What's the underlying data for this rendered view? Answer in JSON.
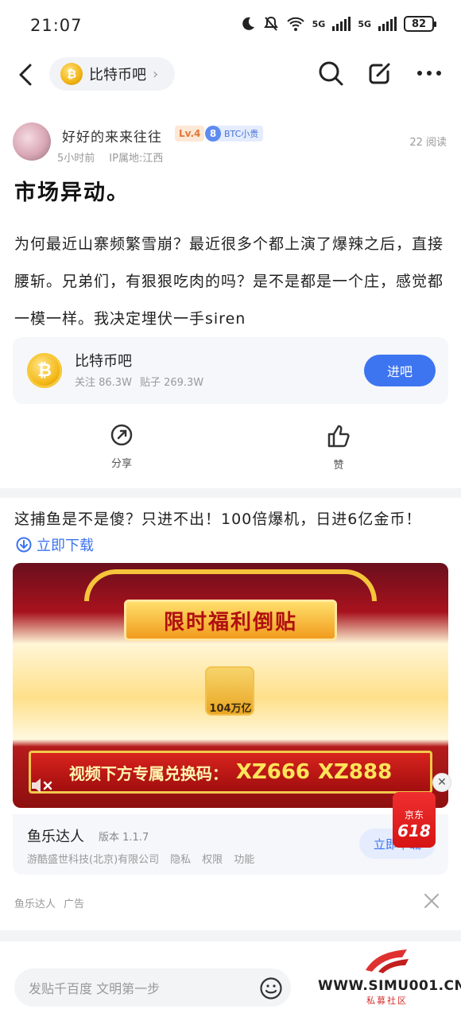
{
  "status_bar": {
    "time": "21:07",
    "network_1": "5G",
    "network_2": "5G",
    "battery": "82"
  },
  "nav": {
    "forum_name": "比特币吧",
    "coin_symbol": "₿"
  },
  "author": {
    "name": "好好的来来往往",
    "level": "Lv.4",
    "badge_number": "8",
    "badge_text": "BTC小贵",
    "time": "5小时前",
    "ip": "IP属地:江西",
    "reads": "22 阅读"
  },
  "post": {
    "title": "市场异动。",
    "body": "为何最近山寨频繁雪崩？最近很多个都上演了爆辣之后，直接腰斩。兄弟们，有狠狠吃肉的吗？是不是都是一个庄，感觉都一模一样。我决定埋伏一手siren"
  },
  "forum_card": {
    "name": "比特币吧",
    "follows": "关注 86.3W",
    "posts": "贴子 269.3W",
    "enter_label": "进吧"
  },
  "actions": {
    "share_label": "分享",
    "like_label": "赞"
  },
  "ad": {
    "headline": "这捕鱼是不是傻？只进不出！100倍爆机，日进6亿金币！",
    "download_label": "立即下载",
    "banner_title": "限时福利倒贴",
    "coin_label": "104万亿",
    "code_label": "视频下方专属兑换码：",
    "code_1": "XZ666",
    "code_2": "XZ888",
    "app_name": "鱼乐达人",
    "app_version": "版本 1.1.7",
    "app_company": "游酷盛世科技(北京)有限公司",
    "app_privacy": "隐私",
    "app_permission": "权限",
    "app_function": "功能",
    "app_button": "立即下载",
    "jd_top": "京东",
    "jd_num": "618",
    "source_name": "鱼乐达人",
    "source_tag": "广告"
  },
  "bottom": {
    "reply_placeholder": "发贴千百度 文明第一步"
  },
  "watermark": {
    "url": "WWW.SIMU001.CN",
    "sub": "私募社区"
  },
  "colors": {
    "accent": "#3d74f0",
    "level": "#e0773a",
    "ad_red": "#d61414"
  }
}
